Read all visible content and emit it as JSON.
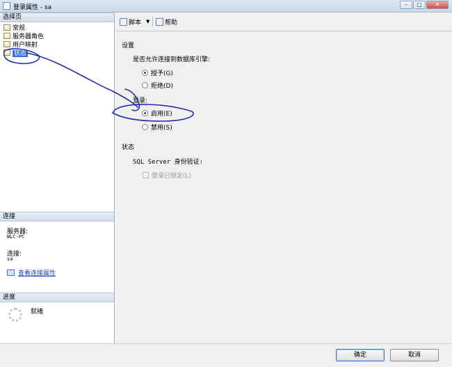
{
  "window": {
    "title": "登录属性 - sa",
    "min_glyph": "–",
    "max_glyph": "□",
    "close_glyph": "✕"
  },
  "left": {
    "select_page_header": "选择页",
    "pages": [
      {
        "label": "常规",
        "selected": false
      },
      {
        "label": "服务器角色",
        "selected": false
      },
      {
        "label": "用户映射",
        "selected": false
      },
      {
        "label": "状态",
        "selected": true
      }
    ],
    "connection_header": "连接",
    "server_label": "服务器:",
    "server_value": "WLC-PC",
    "connection_label": "连接:",
    "connection_value": "sa",
    "view_connection_link": "查看连接属性",
    "progress_header": "进度",
    "progress_status": "就绪"
  },
  "toolbar": {
    "script_label": "脚本",
    "help_label": "帮助"
  },
  "settings": {
    "section_title": "设置",
    "permission_question": "是否允许连接到数据库引擎:",
    "grant_label": "授予(G)",
    "deny_label": "拒绝(D)",
    "permission_selected": "grant",
    "login_group_label": "登录:",
    "enabled_label": "启用(E)",
    "disabled_label": "禁用(S)",
    "login_selected": "enabled"
  },
  "status": {
    "section_title": "状态",
    "auth_label": "SQL Server 身份验证:",
    "locked_label": "登录已锁定(L)"
  },
  "buttons": {
    "ok_label": "确定",
    "cancel_label": "取消"
  },
  "colors": {
    "annotation_ink": "#1f2fa6",
    "selection": "#3a6fd8"
  }
}
